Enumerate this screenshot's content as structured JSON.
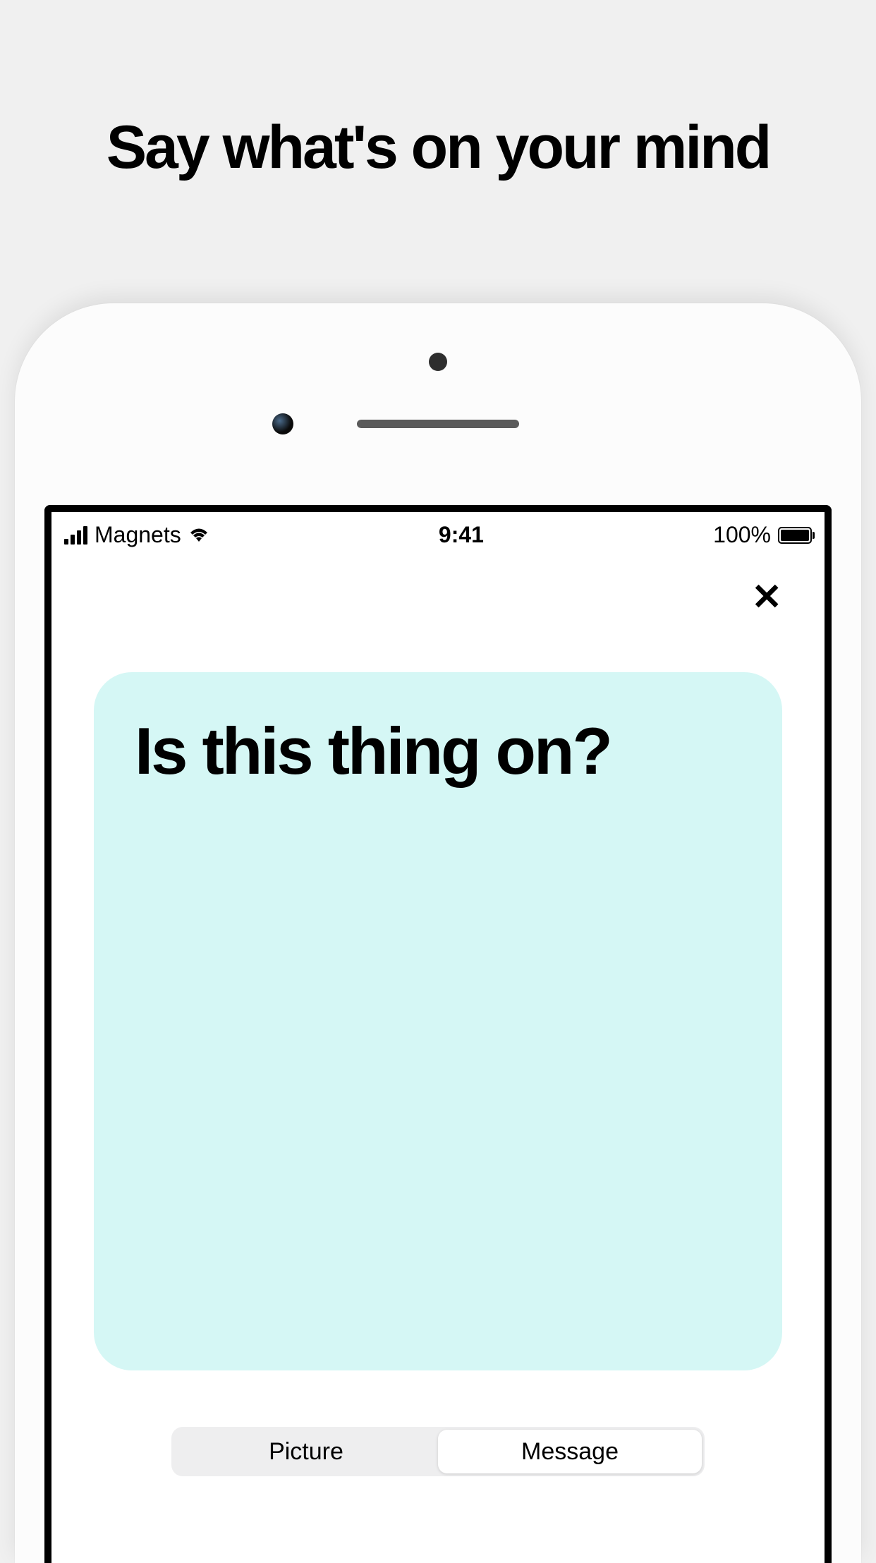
{
  "headline": "Say what's on your mind",
  "status_bar": {
    "carrier": "Magnets",
    "time": "9:41",
    "battery_pct": "100%"
  },
  "nav": {
    "close_label": "✕"
  },
  "compose": {
    "text": "Is this thing on?",
    "card_bg": "#d5f7f5"
  },
  "segmented": {
    "picture_label": "Picture",
    "message_label": "Message"
  }
}
